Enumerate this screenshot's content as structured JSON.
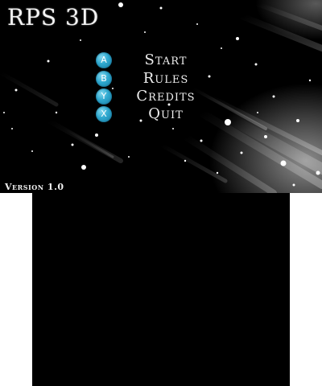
{
  "game": {
    "title": "RPS 3D",
    "version": "Version 1.0"
  },
  "menu": {
    "items": [
      {
        "button": "A",
        "label": "Start"
      },
      {
        "button": "B",
        "label": "Rules"
      },
      {
        "button": "Y",
        "label": "Credits"
      },
      {
        "button": "X",
        "label": "Quit"
      }
    ]
  },
  "colors": {
    "screen_background": "#000000",
    "button_badge": "#2ea8cf",
    "text": "#eeeeee"
  }
}
